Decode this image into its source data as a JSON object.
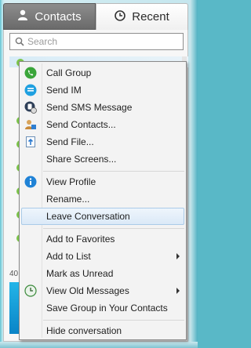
{
  "tabs": [
    {
      "label": "Contacts",
      "icon": "person-icon"
    },
    {
      "label": "Recent",
      "icon": "clock-icon"
    }
  ],
  "search": {
    "placeholder": "Search"
  },
  "status_strip": {
    "text": "40"
  },
  "context_menu": {
    "items": [
      {
        "label": "Call Group",
        "icon": "call-icon"
      },
      {
        "label": "Send IM",
        "icon": "chat-icon"
      },
      {
        "label": "Send SMS Message",
        "icon": "sms-icon"
      },
      {
        "label": "Send Contacts...",
        "icon": "send-contacts-icon"
      },
      {
        "label": "Send File...",
        "icon": "send-file-icon"
      },
      {
        "label": "Share Screens..."
      },
      {
        "label": "View Profile",
        "icon": "info-icon"
      },
      {
        "label": "Rename..."
      },
      {
        "label": "Leave Conversation",
        "highlighted": true
      },
      {
        "label": "Add to Favorites"
      },
      {
        "label": "Add to List",
        "has_submenu": true
      },
      {
        "label": "Mark as Unread"
      },
      {
        "label": "View Old Messages",
        "icon": "clock-icon",
        "has_submenu": true
      },
      {
        "label": "Save Group in Your Contacts"
      },
      {
        "label": "Hide conversation"
      }
    ]
  },
  "colors": {
    "accent": "#00aff0",
    "call_green": "#3aa53a",
    "info_blue": "#1f82d6",
    "highlight": "#dbe9f7"
  }
}
